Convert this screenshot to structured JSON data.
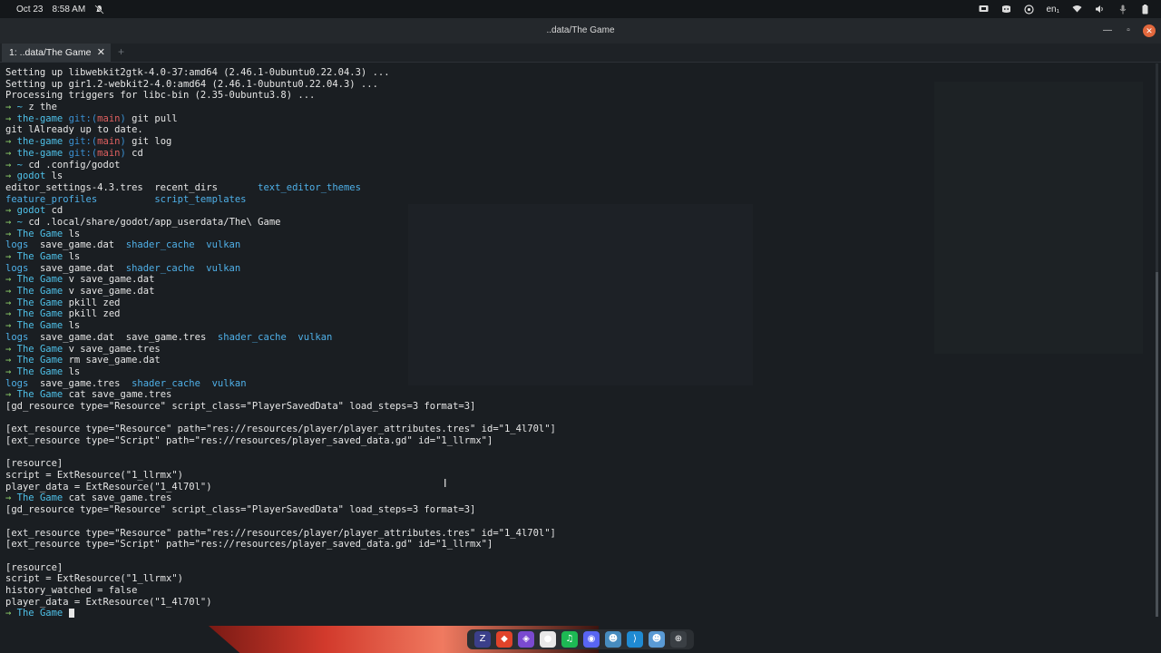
{
  "system_bar": {
    "date": "Oct 23",
    "time": "8:58 AM",
    "keyboard_layout": "en₁"
  },
  "window": {
    "title": "..data/The Game"
  },
  "tabs": [
    {
      "label": "1: ..data/The Game"
    }
  ],
  "terminal": {
    "lines": [
      [
        {
          "t": "Setting up libwebkit2gtk-4.0-37:amd64 (2.46.1-0ubuntu0.22.04.3) ...",
          "c": "file"
        }
      ],
      [
        {
          "t": "Setting up gir1.2-webkit2-4.0:amd64 (2.46.1-0ubuntu0.22.04.3) ...",
          "c": "file"
        }
      ],
      [
        {
          "t": "Processing triggers for libc-bin (2.35-0ubuntu3.8) ...",
          "c": "file"
        }
      ],
      [
        {
          "t": "→ ",
          "c": "arrow"
        },
        {
          "t": "~ ",
          "c": "dir"
        },
        {
          "t": "z the",
          "c": "file"
        }
      ],
      [
        {
          "t": "→ ",
          "c": "arrow"
        },
        {
          "t": "the-game ",
          "c": "dir"
        },
        {
          "t": "git:(",
          "c": "git"
        },
        {
          "t": "main",
          "c": "branch"
        },
        {
          "t": ") ",
          "c": "git"
        },
        {
          "t": "git pull",
          "c": "file"
        }
      ],
      [
        {
          "t": "git lAlready up to date.",
          "c": "file"
        }
      ],
      [
        {
          "t": "→ ",
          "c": "arrow"
        },
        {
          "t": "the-game ",
          "c": "dir"
        },
        {
          "t": "git:(",
          "c": "git"
        },
        {
          "t": "main",
          "c": "branch"
        },
        {
          "t": ") ",
          "c": "git"
        },
        {
          "t": "git log",
          "c": "file"
        }
      ],
      [
        {
          "t": "→ ",
          "c": "arrow"
        },
        {
          "t": "the-game ",
          "c": "dir"
        },
        {
          "t": "git:(",
          "c": "git"
        },
        {
          "t": "main",
          "c": "branch"
        },
        {
          "t": ") ",
          "c": "git"
        },
        {
          "t": "cd",
          "c": "file"
        }
      ],
      [
        {
          "t": "→ ",
          "c": "arrow"
        },
        {
          "t": "~ ",
          "c": "dir"
        },
        {
          "t": "cd .config/godot",
          "c": "file"
        }
      ],
      [
        {
          "t": "→ ",
          "c": "arrow"
        },
        {
          "t": "godot ",
          "c": "dir"
        },
        {
          "t": "ls",
          "c": "file"
        }
      ],
      [
        {
          "t": "editor_settings-4.3.tres  recent_dirs       ",
          "c": "file"
        },
        {
          "t": "text_editor_themes",
          "c": "dirfile"
        }
      ],
      [
        {
          "t": "feature_profiles          script_templates",
          "c": "dirfile"
        }
      ],
      [
        {
          "t": "→ ",
          "c": "arrow"
        },
        {
          "t": "godot ",
          "c": "dir"
        },
        {
          "t": "cd",
          "c": "file"
        }
      ],
      [
        {
          "t": "→ ",
          "c": "arrow"
        },
        {
          "t": "~ ",
          "c": "dir"
        },
        {
          "t": "cd .local/share/godot/app_userdata/The\\ Game",
          "c": "file"
        }
      ],
      [
        {
          "t": "→ ",
          "c": "arrow"
        },
        {
          "t": "The Game ",
          "c": "dir"
        },
        {
          "t": "ls",
          "c": "file"
        }
      ],
      [
        {
          "t": "logs",
          "c": "dirfile"
        },
        {
          "t": "  save_game.dat  ",
          "c": "file"
        },
        {
          "t": "shader_cache  vulkan",
          "c": "dirfile"
        }
      ],
      [
        {
          "t": "→ ",
          "c": "arrow"
        },
        {
          "t": "The Game ",
          "c": "dir"
        },
        {
          "t": "ls",
          "c": "file"
        }
      ],
      [
        {
          "t": "logs",
          "c": "dirfile"
        },
        {
          "t": "  save_game.dat  ",
          "c": "file"
        },
        {
          "t": "shader_cache  vulkan",
          "c": "dirfile"
        }
      ],
      [
        {
          "t": "→ ",
          "c": "arrow"
        },
        {
          "t": "The Game ",
          "c": "dir"
        },
        {
          "t": "v save_game.dat",
          "c": "file"
        }
      ],
      [
        {
          "t": "→ ",
          "c": "arrow"
        },
        {
          "t": "The Game ",
          "c": "dir"
        },
        {
          "t": "v save_game.dat",
          "c": "file"
        }
      ],
      [
        {
          "t": "→ ",
          "c": "arrow"
        },
        {
          "t": "The Game ",
          "c": "dir"
        },
        {
          "t": "pkill zed",
          "c": "file"
        }
      ],
      [
        {
          "t": "→ ",
          "c": "arrow"
        },
        {
          "t": "The Game ",
          "c": "dir"
        },
        {
          "t": "pkill zed",
          "c": "file"
        }
      ],
      [
        {
          "t": "→ ",
          "c": "arrow"
        },
        {
          "t": "The Game ",
          "c": "dir"
        },
        {
          "t": "ls",
          "c": "file"
        }
      ],
      [
        {
          "t": "logs",
          "c": "dirfile"
        },
        {
          "t": "  save_game.dat  save_game.tres  ",
          "c": "file"
        },
        {
          "t": "shader_cache  vulkan",
          "c": "dirfile"
        }
      ],
      [
        {
          "t": "→ ",
          "c": "arrow"
        },
        {
          "t": "The Game ",
          "c": "dir"
        },
        {
          "t": "v save_game.tres",
          "c": "file"
        }
      ],
      [
        {
          "t": "→ ",
          "c": "arrow"
        },
        {
          "t": "The Game ",
          "c": "dir"
        },
        {
          "t": "rm save_game.dat",
          "c": "file"
        }
      ],
      [
        {
          "t": "→ ",
          "c": "arrow"
        },
        {
          "t": "The Game ",
          "c": "dir"
        },
        {
          "t": "ls",
          "c": "file"
        }
      ],
      [
        {
          "t": "logs",
          "c": "dirfile"
        },
        {
          "t": "  save_game.tres  ",
          "c": "file"
        },
        {
          "t": "shader_cache  vulkan",
          "c": "dirfile"
        }
      ],
      [
        {
          "t": "→ ",
          "c": "arrow"
        },
        {
          "t": "The Game ",
          "c": "dir"
        },
        {
          "t": "cat save_game.tres",
          "c": "file"
        }
      ],
      [
        {
          "t": "[gd_resource type=\"Resource\" script_class=\"PlayerSavedData\" load_steps=3 format=3]",
          "c": "file"
        }
      ],
      [
        {
          "t": "",
          "c": "file"
        }
      ],
      [
        {
          "t": "[ext_resource type=\"Resource\" path=\"res://resources/player/player_attributes.tres\" id=\"1_4l70l\"]",
          "c": "file"
        }
      ],
      [
        {
          "t": "[ext_resource type=\"Script\" path=\"res://resources/player_saved_data.gd\" id=\"1_llrmx\"]",
          "c": "file"
        }
      ],
      [
        {
          "t": "",
          "c": "file"
        }
      ],
      [
        {
          "t": "[resource]",
          "c": "file"
        }
      ],
      [
        {
          "t": "script = ExtResource(\"1_llrmx\")",
          "c": "file"
        }
      ],
      [
        {
          "t": "player_data = ExtResource(\"1_4l70l\")",
          "c": "file"
        }
      ],
      [
        {
          "t": "→ ",
          "c": "arrow"
        },
        {
          "t": "The Game ",
          "c": "dir"
        },
        {
          "t": "cat save_game.tres",
          "c": "file"
        }
      ],
      [
        {
          "t": "[gd_resource type=\"Resource\" script_class=\"PlayerSavedData\" load_steps=3 format=3]",
          "c": "file"
        }
      ],
      [
        {
          "t": "",
          "c": "file"
        }
      ],
      [
        {
          "t": "[ext_resource type=\"Resource\" path=\"res://resources/player/player_attributes.tres\" id=\"1_4l70l\"]",
          "c": "file"
        }
      ],
      [
        {
          "t": "[ext_resource type=\"Script\" path=\"res://resources/player_saved_data.gd\" id=\"1_llrmx\"]",
          "c": "file"
        }
      ],
      [
        {
          "t": "",
          "c": "file"
        }
      ],
      [
        {
          "t": "[resource]",
          "c": "file"
        }
      ],
      [
        {
          "t": "script = ExtResource(\"1_llrmx\")",
          "c": "file"
        }
      ],
      [
        {
          "t": "history_watched = false",
          "c": "file"
        }
      ],
      [
        {
          "t": "player_data = ExtResource(\"1_4l70l\")",
          "c": "file"
        }
      ],
      [
        {
          "t": "→ ",
          "c": "arrow"
        },
        {
          "t": "The Game ",
          "c": "dir"
        }
      ]
    ]
  },
  "dock": {
    "apps": [
      {
        "icon": "zed-icon",
        "glyph": "Z",
        "color": "#3b3f8a"
      },
      {
        "icon": "brave-icon",
        "glyph": "◆",
        "color": "#e0432a"
      },
      {
        "icon": "obsidian-icon",
        "glyph": "◈",
        "color": "#7a4ad0"
      },
      {
        "icon": "chrome-icon",
        "glyph": "●",
        "color": "#e8e8e8"
      },
      {
        "icon": "spotify-icon",
        "glyph": "♫",
        "color": "#1db954"
      },
      {
        "icon": "discord-icon",
        "glyph": "◉",
        "color": "#5865f2"
      },
      {
        "icon": "godot-icon",
        "glyph": "☻",
        "color": "#478cbf"
      },
      {
        "icon": "vscode-icon",
        "glyph": "⟩",
        "color": "#1f8ad2"
      },
      {
        "icon": "godot-alt-icon",
        "glyph": "☻",
        "color": "#5a9ad4"
      },
      {
        "icon": "apps-grid-icon",
        "glyph": "⊕",
        "color": "#3a3f44"
      }
    ]
  }
}
